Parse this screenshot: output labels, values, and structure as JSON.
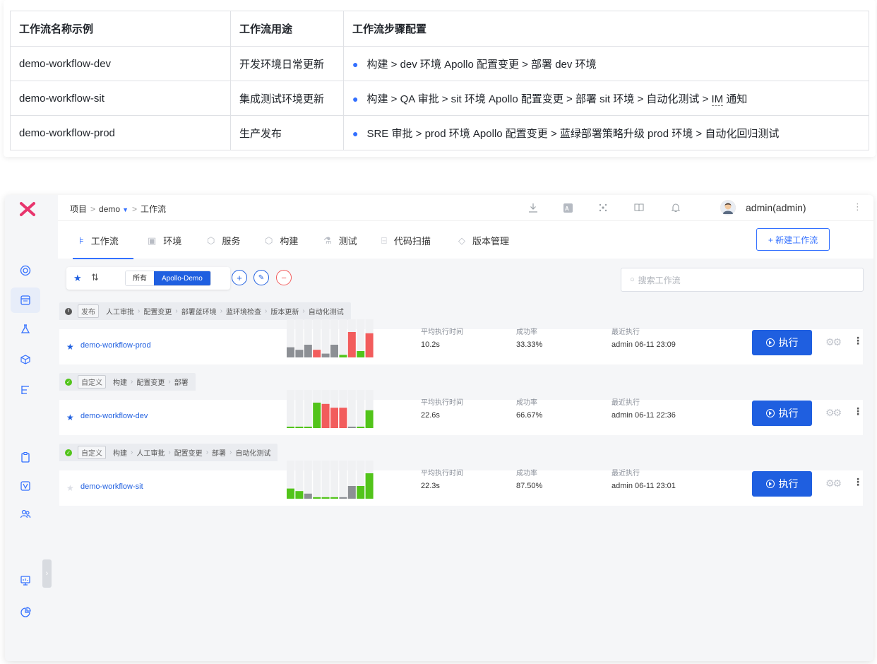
{
  "doc_table": {
    "headers": [
      "工作流名称示例",
      "工作流用途",
      "工作流步骤配置"
    ],
    "rows": [
      {
        "name": "demo-workflow-dev",
        "purpose": "开发环境日常更新",
        "steps": "构建 > dev 环境 Apollo 配置变更 > 部署 dev 环境"
      },
      {
        "name": "demo-workflow-sit",
        "purpose": "集成测试环境更新",
        "steps_pre": "构建 > QA 审批 > sit 环境 Apollo 配置变更 > 部署 sit 环境 > 自动化测试 > ",
        "steps_im": "IM",
        "steps_post": " 通知"
      },
      {
        "name": "demo-workflow-prod",
        "purpose": "生产发布",
        "steps": "SRE 审批 > prod 环境 Apollo 配置变更 > 蓝绿部署策略升级 prod 环境 > 自动化回归测试"
      }
    ]
  },
  "app": {
    "breadcrumb": {
      "root": "项目",
      "project": "demo",
      "current": "工作流"
    },
    "user": "admin(admin)",
    "tabs": [
      {
        "label": "工作流",
        "icon": "workflow-icon"
      },
      {
        "label": "环境",
        "icon": "environment-icon"
      },
      {
        "label": "服务",
        "icon": "service-icon"
      },
      {
        "label": "构建",
        "icon": "build-icon"
      },
      {
        "label": "测试",
        "icon": "test-icon"
      },
      {
        "label": "代码扫描",
        "icon": "scan-icon"
      },
      {
        "label": "版本管理",
        "icon": "version-icon"
      }
    ],
    "new_button": "+ 新建工作流",
    "filter": {
      "all": "所有",
      "selected": "Apollo-Demo"
    },
    "search_placeholder": "搜索工作流",
    "metric_labels": {
      "avg": "平均执行时间",
      "rate": "成功率",
      "last": "最近执行"
    },
    "run_label": "执行",
    "workflows": [
      {
        "name": "demo-workflow-prod",
        "starred": true,
        "status": "info",
        "type_tag": "发布",
        "stages": [
          "人工审批",
          "配置变更",
          "部署蓝环境",
          "蓝环境检查",
          "版本更新",
          "自动化测试"
        ],
        "avg_time": "10.2s",
        "success_rate": "33.33%",
        "last_run": "admin 06-11 23:09",
        "bars": [
          {
            "h": 0.4,
            "c": "gray"
          },
          {
            "h": 0.3,
            "c": "gray"
          },
          {
            "h": 0.5,
            "c": "gray"
          },
          {
            "h": 0.3,
            "c": "red"
          },
          {
            "h": 0.15,
            "c": "gray"
          },
          {
            "h": 0.5,
            "c": "gray"
          },
          {
            "h": 0.1,
            "c": "green"
          },
          {
            "h": 1.0,
            "c": "red"
          },
          {
            "h": 0.25,
            "c": "green"
          },
          {
            "h": 0.95,
            "c": "red"
          }
        ]
      },
      {
        "name": "demo-workflow-dev",
        "starred": true,
        "status": "success",
        "type_tag": "自定义",
        "stages": [
          "构建",
          "配置变更",
          "部署"
        ],
        "avg_time": "22.6s",
        "success_rate": "66.67%",
        "last_run": "admin 06-11 22:36",
        "bars": [
          {
            "h": 0.04,
            "c": "green"
          },
          {
            "h": 0.04,
            "c": "green"
          },
          {
            "h": 0.04,
            "c": "green"
          },
          {
            "h": 1.0,
            "c": "green"
          },
          {
            "h": 0.95,
            "c": "red"
          },
          {
            "h": 0.8,
            "c": "red"
          },
          {
            "h": 0.8,
            "c": "red"
          },
          {
            "h": 0.04,
            "c": "gray"
          },
          {
            "h": 0.04,
            "c": "green"
          },
          {
            "h": 0.7,
            "c": "green"
          }
        ]
      },
      {
        "name": "demo-workflow-sit",
        "starred": false,
        "status": "success",
        "type_tag": "自定义",
        "stages": [
          "构建",
          "人工审批",
          "配置变更",
          "部署",
          "自动化测试"
        ],
        "avg_time": "22.3s",
        "success_rate": "87.50%",
        "last_run": "admin 06-11 23:01",
        "bars": [
          {
            "h": 0.4,
            "c": "green"
          },
          {
            "h": 0.3,
            "c": "green"
          },
          {
            "h": 0.2,
            "c": "gray"
          },
          {
            "h": 0.06,
            "c": "green"
          },
          {
            "h": 0.06,
            "c": "green"
          },
          {
            "h": 0.06,
            "c": "green"
          },
          {
            "h": 0.06,
            "c": "gray"
          },
          {
            "h": 0.5,
            "c": "gray"
          },
          {
            "h": 0.5,
            "c": "green"
          },
          {
            "h": 1.0,
            "c": "green"
          }
        ]
      }
    ]
  },
  "colors": {
    "accent": "#1f5fe0",
    "green": "#52c41a",
    "red": "#f25c5c",
    "gray": "#8c8f94"
  }
}
